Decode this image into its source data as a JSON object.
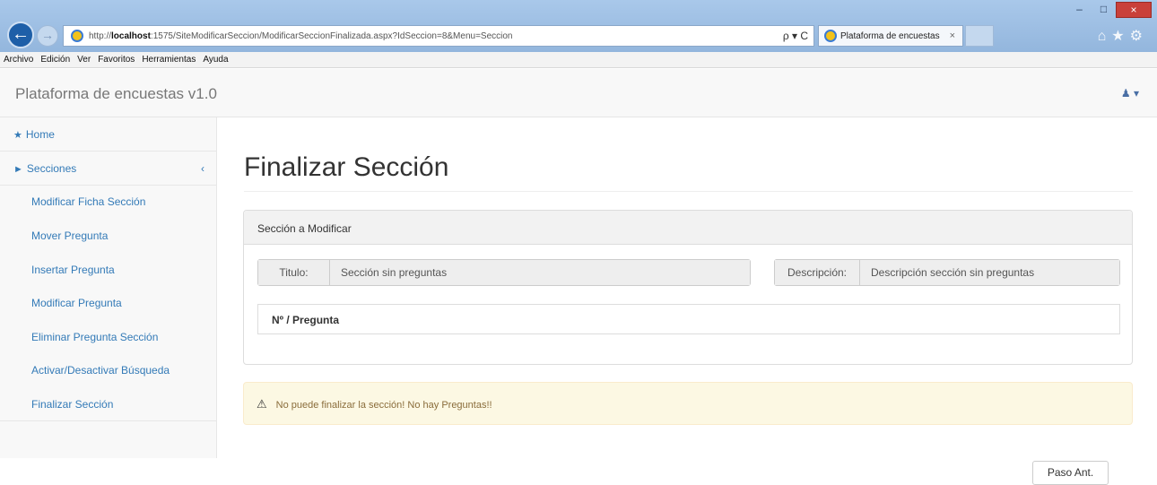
{
  "browser": {
    "url_prefix": "http://",
    "url_host": "localhost",
    "url_rest": ":1575/SiteModificarSeccion/ModificarSeccionFinalizada.aspx?IdSeccion=8&Menu=Seccion",
    "addr_tools": "ρ ▾ C",
    "tab_title": "Plataforma de encuestas",
    "tab_close": "×",
    "menu": [
      "Archivo",
      "Edición",
      "Ver",
      "Favoritos",
      "Herramientas",
      "Ayuda"
    ],
    "win_min": "–",
    "win_max": "□",
    "win_close": "×",
    "chrome_icons": "⌂★⚙"
  },
  "app": {
    "brand": "Plataforma de encuestas v1.0",
    "user_icon": "user-icon"
  },
  "sidebar": {
    "home": "Home",
    "secciones": "Secciones",
    "chevron": "‹",
    "items": [
      "Modificar Ficha Sección",
      "Mover Pregunta",
      "Insertar Pregunta",
      "Modificar Pregunta",
      "Eliminar Pregunta Sección",
      "Activar/Desactivar Búsqueda",
      "Finalizar Sección"
    ]
  },
  "main": {
    "title": "Finalizar Sección",
    "panel_heading": "Sección a Modificar",
    "titulo_label": "Titulo:",
    "titulo_value": "Sección sin preguntas",
    "descripcion_label": "Descripción:",
    "descripcion_value": "Descripción sección sin preguntas",
    "table_header": "Nº / Pregunta",
    "alert_text": "No puede finalizar la sección! No hay Preguntas!!",
    "back_button": "Paso Ant."
  },
  "colors": {
    "link": "#337ab7",
    "alert_bg": "#fcf8e3",
    "alert_text": "#8a6d3b"
  }
}
